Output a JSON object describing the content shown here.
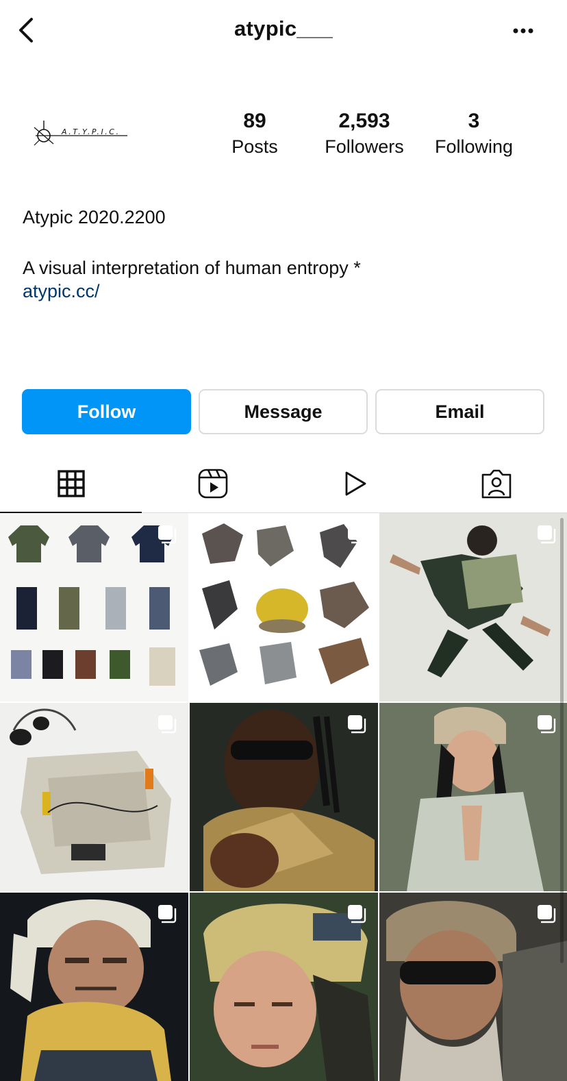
{
  "header": {
    "username": "atypic___"
  },
  "profile": {
    "logo_text": "A.T.Y.P.I.C.",
    "stats": [
      {
        "value": "89",
        "label": "Posts"
      },
      {
        "value": "2,593",
        "label": "Followers"
      },
      {
        "value": "3",
        "label": "Following"
      }
    ],
    "bio_name": "Atypic 2020.2200",
    "bio_desc": "A visual interpretation of human entropy *",
    "bio_link": "atypic.cc/"
  },
  "actions": {
    "follow": "Follow",
    "message": "Message",
    "email": "Email"
  },
  "tabs": [
    {
      "name": "grid",
      "icon": "grid-icon",
      "active": true
    },
    {
      "name": "reels",
      "icon": "reels-icon",
      "active": false
    },
    {
      "name": "videos",
      "icon": "play-icon",
      "active": false
    },
    {
      "name": "tagged",
      "icon": "tagged-person-icon",
      "active": false
    }
  ],
  "posts": [
    {
      "subject": "clothing-flatlay",
      "multi": true
    },
    {
      "subject": "collage-objects",
      "multi": true
    },
    {
      "subject": "model-jumping-bag",
      "multi": true
    },
    {
      "subject": "bag-headphones-flatlay",
      "multi": true
    },
    {
      "subject": "man-sunglasses-fur-collar",
      "multi": true
    },
    {
      "subject": "woman-beanie-jacket",
      "multi": true
    },
    {
      "subject": "man-headscarf",
      "multi": true
    },
    {
      "subject": "woman-fur-hat",
      "multi": true
    },
    {
      "subject": "man-fur-hat-sunglasses",
      "multi": true
    }
  ],
  "colors": {
    "follow_blue": "#0095f6",
    "link_blue": "#00376b",
    "border_gray": "#dbdbdb"
  }
}
